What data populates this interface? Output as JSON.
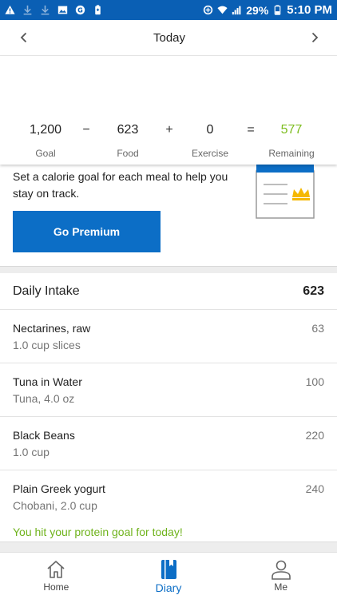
{
  "status_bar": {
    "battery_percent": "29%",
    "time": "5:10 PM",
    "icons": [
      "warning-icon",
      "download-icon",
      "download-icon",
      "image-icon",
      "g-app-icon",
      "battery-saver-icon",
      "data-saver-icon",
      "wifi-icon",
      "signal-icon",
      "battery-icon"
    ]
  },
  "header": {
    "title": "Today",
    "prev_icon": "chevron-left-icon",
    "next_icon": "chevron-right-icon"
  },
  "summary": {
    "goal": "1,200",
    "minus": "−",
    "food": "623",
    "plus": "+",
    "exercise": "0",
    "equals": "=",
    "remaining": "577",
    "goal_label": "Goal",
    "food_label": "Food",
    "exercise_label": "Exercise",
    "remaining_label": "Remaining",
    "remaining_color": "#7dbd1f"
  },
  "promo": {
    "text": "Set a calorie goal for each meal to help you stay on track.",
    "button_label": "Go Premium",
    "button_color": "#0c6ec6"
  },
  "intake": {
    "title": "Daily Intake",
    "total": "623",
    "items": [
      {
        "name": "Nectarines, raw",
        "detail": "1.0 cup slices",
        "calories": "63"
      },
      {
        "name": "Tuna in Water",
        "detail": "Tuna, 4.0 oz",
        "calories": "100"
      },
      {
        "name": "Black Beans",
        "detail": "1.0 cup",
        "calories": "220"
      },
      {
        "name": "Plain Greek yogurt",
        "detail": "Chobani, 2.0 cup",
        "calories": "240"
      }
    ],
    "protein_message": "You hit your protein goal for today!",
    "protein_color": "#6fb31c"
  },
  "bottom_nav": {
    "home_label": "Home",
    "diary_label": "Diary",
    "me_label": "Me",
    "active": "Diary",
    "accent_color": "#0c6ec6"
  }
}
